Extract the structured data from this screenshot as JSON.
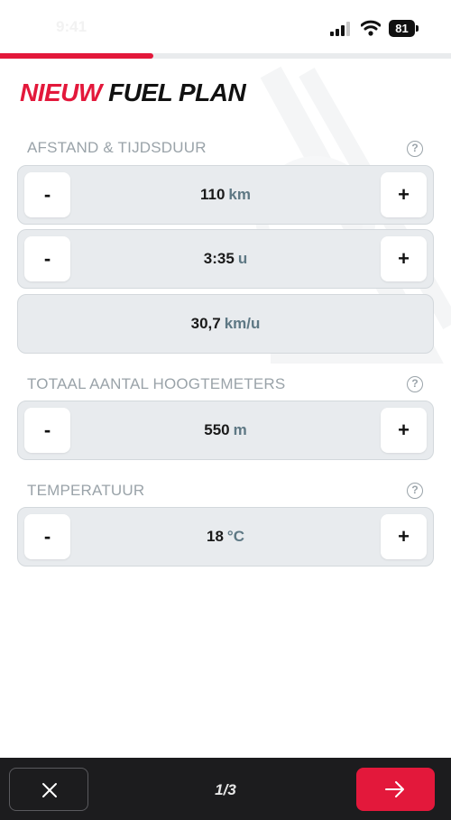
{
  "status_bar": {
    "time": "9:41",
    "battery": "81",
    "icons": [
      "signal-icon",
      "wifi-icon",
      "battery-icon"
    ]
  },
  "progress": {
    "fraction": 0.34
  },
  "title": {
    "accent": "NIEUW",
    "main": "FUEL PLAN"
  },
  "sections": {
    "distance": {
      "label": "AFSTAND & TIJDSDUUR",
      "distance_value": "110",
      "distance_unit": "km",
      "duration_value": "3:35",
      "duration_unit": "u",
      "speed_value": "30,7",
      "speed_unit": "km/u"
    },
    "elevation": {
      "label": "TOTAAL AANTAL HOOGTEMETERS",
      "value": "550",
      "unit": "m"
    },
    "temperature": {
      "label": "TEMPERATUUR",
      "value": "18",
      "unit": "°C"
    }
  },
  "controls": {
    "minus": "-",
    "plus": "+",
    "help": "?"
  },
  "footer": {
    "page_indicator": "1/3"
  },
  "colors": {
    "accent": "#e3183b",
    "field_background": "#e8ebee",
    "label": "#9aa3a9",
    "unit": "#5e7884",
    "footer": "#1c1c1e"
  }
}
